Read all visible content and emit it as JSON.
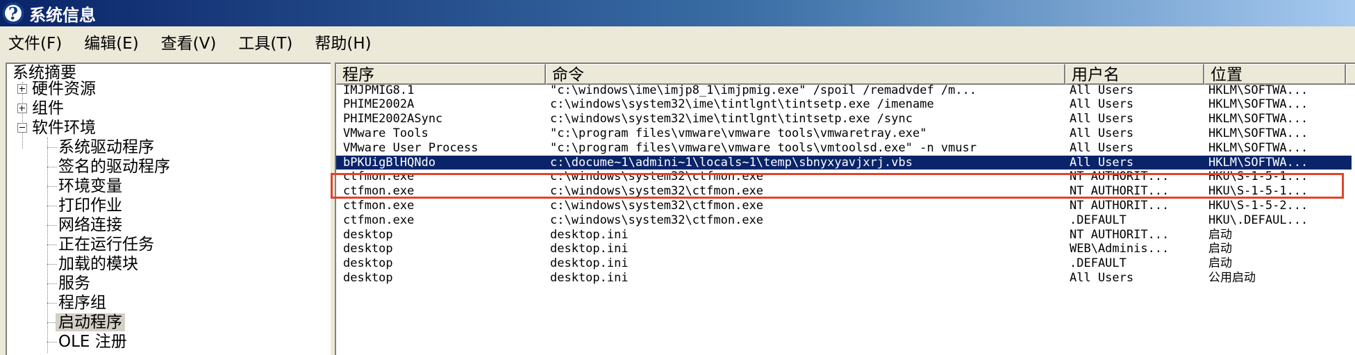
{
  "window": {
    "title": "系统信息",
    "icon": "help-icon"
  },
  "menu": [
    {
      "label": "文件(F)"
    },
    {
      "label": "编辑(E)"
    },
    {
      "label": "查看(V)"
    },
    {
      "label": "工具(T)"
    },
    {
      "label": "帮助(H)"
    }
  ],
  "tree": {
    "root": "系统摘要",
    "level1": [
      {
        "label": "硬件资源",
        "expander": "plus"
      },
      {
        "label": "组件",
        "expander": "plus"
      },
      {
        "label": "软件环境",
        "expander": "minus"
      }
    ],
    "children": [
      {
        "label": "系统驱动程序"
      },
      {
        "label": "签名的驱动程序"
      },
      {
        "label": "环境变量"
      },
      {
        "label": "打印作业"
      },
      {
        "label": "网络连接"
      },
      {
        "label": "正在运行任务"
      },
      {
        "label": "加载的模块"
      },
      {
        "label": "服务"
      },
      {
        "label": "程序组"
      },
      {
        "label": "启动程序",
        "selected": true
      },
      {
        "label": "OLE 注册"
      }
    ]
  },
  "list": {
    "columns": [
      "程序",
      "命令",
      "用户名",
      "位置"
    ],
    "rows": [
      [
        "IMJPMIG8.1",
        "\"c:\\windows\\ime\\imjp8_1\\imjpmig.exe\" /spoil /remadvdef /m...",
        "All Users",
        "HKLM\\SOFTWA..."
      ],
      [
        "PHIME2002A",
        "c:\\windows\\system32\\ime\\tintlgnt\\tintsetp.exe /imename",
        "All Users",
        "HKLM\\SOFTWA..."
      ],
      [
        "PHIME2002ASync",
        "c:\\windows\\system32\\ime\\tintlgnt\\tintsetp.exe /sync",
        "All Users",
        "HKLM\\SOFTWA..."
      ],
      [
        "VMware Tools",
        "\"c:\\program files\\vmware\\vmware tools\\vmwaretray.exe\"",
        "All Users",
        "HKLM\\SOFTWA..."
      ],
      [
        "VMware User Process",
        "\"c:\\program files\\vmware\\vmware tools\\vmtoolsd.exe\" -n vmusr",
        "All Users",
        "HKLM\\SOFTWA..."
      ],
      [
        "bPKUigBlHQNdo",
        "c:\\docume~1\\admini~1\\locals~1\\temp\\sbnyxyavjxrj.vbs",
        "All Users",
        "HKLM\\SOFTWA..."
      ],
      [
        "ctfmon.exe",
        "c:\\windows\\system32\\ctfmon.exe",
        "NT AUTHORIT...",
        "HKU\\S-1-5-1..."
      ],
      [
        "ctfmon.exe",
        "c:\\windows\\system32\\ctfmon.exe",
        "NT AUTHORIT...",
        "HKU\\S-1-5-1..."
      ],
      [
        "ctfmon.exe",
        "c:\\windows\\system32\\ctfmon.exe",
        "NT AUTHORIT...",
        "HKU\\S-1-5-2..."
      ],
      [
        "ctfmon.exe",
        "c:\\windows\\system32\\ctfmon.exe",
        ".DEFAULT",
        "HKU\\.DEFAUL..."
      ],
      [
        "desktop",
        "desktop.ini",
        "NT AUTHORIT...",
        "启动"
      ],
      [
        "desktop",
        "desktop.ini",
        "WEB\\Adminis...",
        "启动"
      ],
      [
        "desktop",
        "desktop.ini",
        ".DEFAULT",
        "启动"
      ],
      [
        "desktop",
        "desktop.ini",
        "All Users",
        "公用启动"
      ]
    ],
    "selected_index": 5
  },
  "colors": {
    "selection": "#0a246a",
    "highlight_border": "#e0442a"
  }
}
